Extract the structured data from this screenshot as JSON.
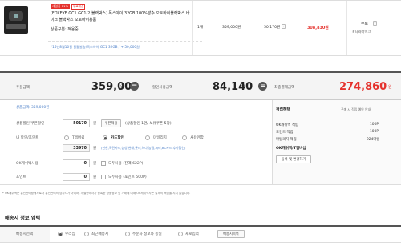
{
  "product": {
    "badge_sale": "세일중 11%",
    "badge_free": "무료배송",
    "title": "[FOXEYE GC1 GC1-2 블랙박스] 폭스아이 32GB 100%방수 오토바이블랙박스 바이크 블랙박스 오토바이용품",
    "option": "상품구분: 적용중",
    "note": "*16년8월10일 일괄발송/폭스아이 GC1 32GB / +,50,000원",
    "qty": "1개",
    "price": "359,000원",
    "discount": "50,170원",
    "final": "308,830원",
    "shipping": "무료",
    "seller": "#니와바이크"
  },
  "summary": {
    "order_label": "주문금액",
    "order_amount": "359,000",
    "won": "원",
    "discount_label": "할인사용금액",
    "discount_amount": "84,140",
    "final_label": "최종결제금액",
    "final_amount": "274,860"
  },
  "discount": {
    "product_amount": "상품금액: 359,000원",
    "coupon_label": "상품할인/쿠폰할인",
    "coupon_value": "50170",
    "coupon_unit": "원",
    "coupon_btn": "쿠폰적용",
    "coupon_info": "(상품할인 1건/ 보유쿠폰 5장)",
    "card_label": "내 할인/포인트",
    "r1": "T멤버쉽",
    "r2": "카드할인",
    "r3": "마일리지",
    "r4": "사용안함",
    "card_value": "33970",
    "card_info": "(신한,국민카드,삼성,현대,롯데,하나,농협,씨티,BC카드 추가할인)",
    "ok_label": "OK캐쉬백사용",
    "ok_value": "0",
    "ok_unit": "원",
    "ok_all": "모두사용 (잔액 622P)",
    "point_label": "포인트",
    "point_value": "0",
    "point_unit": "원",
    "point_all": "모두사용 (포인트 500P)"
  },
  "benefit": {
    "title": "적립혜택",
    "sub": "구매 시 적립 예약 안내",
    "rows": [
      {
        "k": "OK캐쉬백 적립",
        "v": "100P"
      },
      {
        "k": "포인트 적립",
        "v": "100P"
      },
      {
        "k": "마일리지 적립",
        "v": "924마일"
      }
    ],
    "card": "OK캐쉬백/T멤버십",
    "card_btn": "등록 및 변경하기"
  },
  "footnote": "* OK캐쉬백는 통신판매중개자로서 통신판매의 당사자가 아니며, 개별판매자가 등록한 상품정보 및 거래에 대해 OK캐쉬백사는 일체의 책임을 지지 않습니다.",
  "shipping_section": {
    "title": "배송지 정보 입력",
    "row_label": "배송지선택",
    "r1": "우리집",
    "r2": "최근배송지",
    "r3": "주문자 정보와 동일",
    "r4": "새로입력",
    "btn": "배송지목록"
  }
}
